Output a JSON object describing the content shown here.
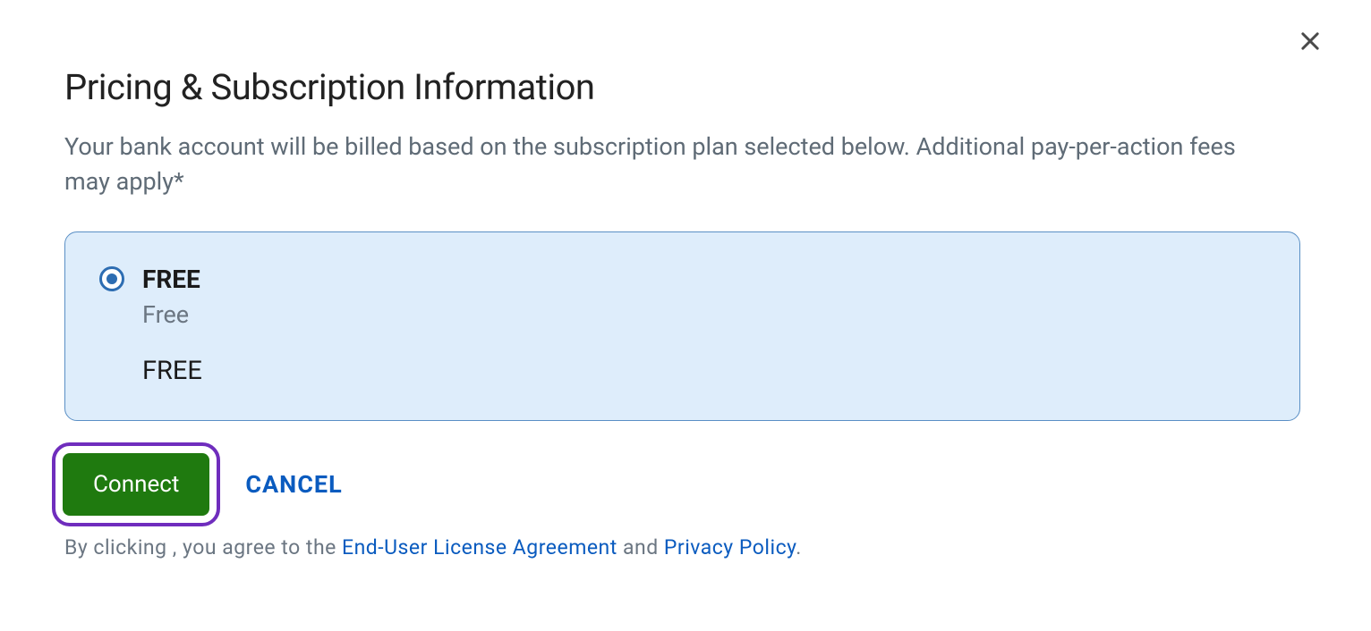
{
  "modal": {
    "title": "Pricing & Subscription Information",
    "subtitle": "Your bank account will be billed based on the subscription plan selected below. Additional pay-per-action fees may apply*",
    "plan": {
      "name": "FREE",
      "description": "Free",
      "price": "FREE",
      "selected": true
    },
    "actions": {
      "connect_label": "Connect",
      "cancel_label": "CANCEL"
    },
    "footer": {
      "prefix": "By clicking , you agree to the ",
      "eula_link": "End-User License Agreement",
      "middle": " and ",
      "privacy_link": "Privacy Policy",
      "suffix": "."
    }
  }
}
